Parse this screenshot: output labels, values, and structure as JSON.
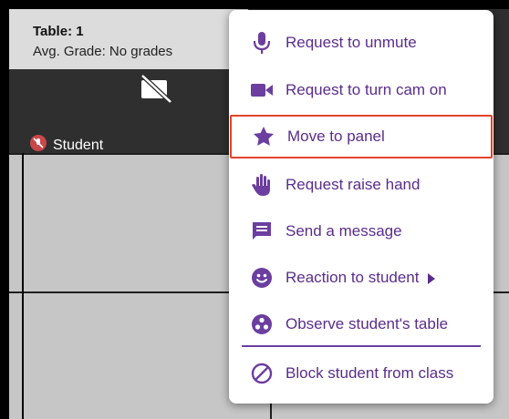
{
  "tile": {
    "title": "Table: 1",
    "grade": "Avg. Grade: No grades",
    "student": "Student"
  },
  "menu": {
    "items": [
      {
        "label": "Request to unmute",
        "icon": "microphone-icon"
      },
      {
        "label": "Request to turn cam on",
        "icon": "video-camera-icon"
      },
      {
        "label": "Move to panel",
        "icon": "star-icon",
        "highlighted": true
      },
      {
        "label": "Request raise hand",
        "icon": "raised-hand-icon"
      },
      {
        "label": "Send a message",
        "icon": "message-icon"
      },
      {
        "label": "Reaction to student",
        "icon": "smiley-icon",
        "has_submenu": true
      },
      {
        "label": "Observe student's table",
        "icon": "observe-table-icon"
      },
      {
        "label": "Block student from class",
        "icon": "block-icon"
      }
    ]
  },
  "colors": {
    "accent": "#6b3ea0",
    "highlight_border": "#e2442a",
    "mic_off": "#c9474a"
  }
}
